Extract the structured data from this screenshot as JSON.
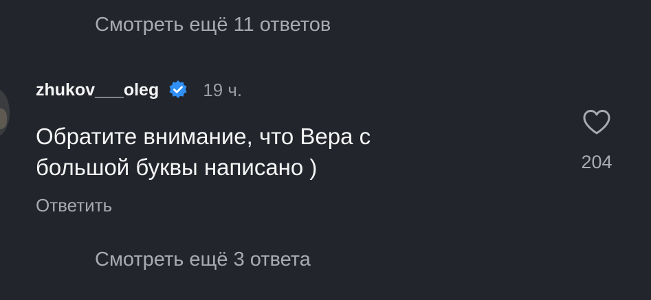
{
  "replies": {
    "view_more_top": "Смотреть ещё 11 ответов",
    "view_more_bottom": "Смотреть ещё 3 ответа"
  },
  "comment": {
    "username": "zhukov___oleg",
    "verified_icon": "verified-badge-icon",
    "timestamp": "19 ч.",
    "text": "Обратите внимание, что Вера с\nбольшой буквы написано )",
    "reply_label": "Ответить",
    "like_icon": "heart-icon",
    "like_count": "204"
  },
  "colors": {
    "background": "#22252c",
    "primary_text": "#f5f5f5",
    "secondary_text": "#a9abb0",
    "verified_blue": "#2f8ff4"
  }
}
